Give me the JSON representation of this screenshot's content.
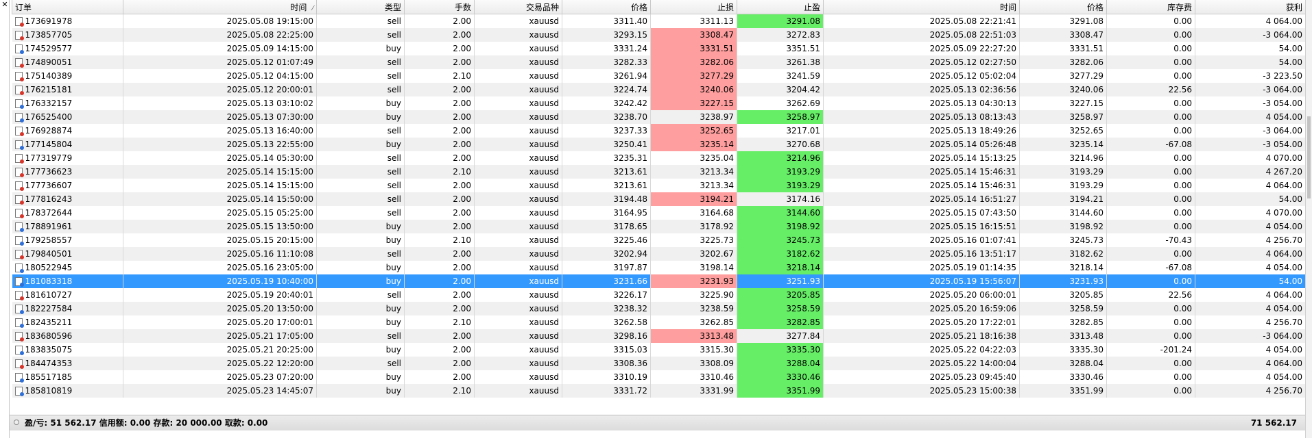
{
  "columns": [
    "订单",
    "时间",
    "类型",
    "手数",
    "交易品种",
    "价格",
    "止损",
    "止盈",
    "时间",
    "价格",
    "库存费",
    "获利"
  ],
  "rows": [
    {
      "id": "173691978",
      "open": "2025.05.08 19:15:00",
      "type": "sell",
      "size": "2.00",
      "symbol": "xauusd",
      "price": "3311.40",
      "sl": "3311.13",
      "tp": "3291.08",
      "close": "2025.05.08 22:21:41",
      "cprice": "3291.08",
      "swap": "0.00",
      "profit": "4 064.00",
      "hl": "tp"
    },
    {
      "id": "173857705",
      "open": "2025.05.08 22:25:00",
      "type": "sell",
      "size": "2.00",
      "symbol": "xauusd",
      "price": "3293.15",
      "sl": "3308.47",
      "tp": "3272.83",
      "close": "2025.05.08 22:51:03",
      "cprice": "3308.47",
      "swap": "0.00",
      "profit": "-3 064.00",
      "hl": "sl"
    },
    {
      "id": "174529577",
      "open": "2025.05.09 14:15:00",
      "type": "buy",
      "size": "2.00",
      "symbol": "xauusd",
      "price": "3331.24",
      "sl": "3331.51",
      "tp": "3351.51",
      "close": "2025.05.09 22:27:20",
      "cprice": "3331.51",
      "swap": "0.00",
      "profit": "54.00",
      "hl": "sl"
    },
    {
      "id": "174890051",
      "open": "2025.05.12 01:07:49",
      "type": "sell",
      "size": "2.00",
      "symbol": "xauusd",
      "price": "3282.33",
      "sl": "3282.06",
      "tp": "3261.38",
      "close": "2025.05.12 02:27:50",
      "cprice": "3282.06",
      "swap": "0.00",
      "profit": "54.00",
      "hl": "sl"
    },
    {
      "id": "175140389",
      "open": "2025.05.12 04:15:00",
      "type": "sell",
      "size": "2.10",
      "symbol": "xauusd",
      "price": "3261.94",
      "sl": "3277.29",
      "tp": "3241.59",
      "close": "2025.05.12 05:02:04",
      "cprice": "3277.29",
      "swap": "0.00",
      "profit": "-3 223.50",
      "hl": "sl"
    },
    {
      "id": "176215181",
      "open": "2025.05.12 20:00:01",
      "type": "sell",
      "size": "2.00",
      "symbol": "xauusd",
      "price": "3224.74",
      "sl": "3240.06",
      "tp": "3204.42",
      "close": "2025.05.13 02:36:56",
      "cprice": "3240.06",
      "swap": "22.56",
      "profit": "-3 064.00",
      "hl": "sl"
    },
    {
      "id": "176332157",
      "open": "2025.05.13 03:10:02",
      "type": "buy",
      "size": "2.00",
      "symbol": "xauusd",
      "price": "3242.42",
      "sl": "3227.15",
      "tp": "3262.69",
      "close": "2025.05.13 04:30:13",
      "cprice": "3227.15",
      "swap": "0.00",
      "profit": "-3 054.00",
      "hl": "sl"
    },
    {
      "id": "176525400",
      "open": "2025.05.13 07:30:00",
      "type": "buy",
      "size": "2.00",
      "symbol": "xauusd",
      "price": "3238.70",
      "sl": "3238.97",
      "tp": "3258.97",
      "close": "2025.05.13 08:13:43",
      "cprice": "3258.97",
      "swap": "0.00",
      "profit": "4 054.00",
      "hl": "tp"
    },
    {
      "id": "176928874",
      "open": "2025.05.13 16:40:00",
      "type": "sell",
      "size": "2.00",
      "symbol": "xauusd",
      "price": "3237.33",
      "sl": "3252.65",
      "tp": "3217.01",
      "close": "2025.05.13 18:49:26",
      "cprice": "3252.65",
      "swap": "0.00",
      "profit": "-3 064.00",
      "hl": "sl"
    },
    {
      "id": "177145804",
      "open": "2025.05.13 22:55:00",
      "type": "buy",
      "size": "2.00",
      "symbol": "xauusd",
      "price": "3250.41",
      "sl": "3235.14",
      "tp": "3270.68",
      "close": "2025.05.14 05:26:48",
      "cprice": "3235.14",
      "swap": "-67.08",
      "profit": "-3 054.00",
      "hl": "sl"
    },
    {
      "id": "177319779",
      "open": "2025.05.14 05:30:00",
      "type": "sell",
      "size": "2.00",
      "symbol": "xauusd",
      "price": "3235.31",
      "sl": "3235.04",
      "tp": "3214.96",
      "close": "2025.05.14 15:13:25",
      "cprice": "3214.96",
      "swap": "0.00",
      "profit": "4 070.00",
      "hl": "tp"
    },
    {
      "id": "177736623",
      "open": "2025.05.14 15:15:00",
      "type": "sell",
      "size": "2.10",
      "symbol": "xauusd",
      "price": "3213.61",
      "sl": "3213.34",
      "tp": "3193.29",
      "close": "2025.05.14 15:46:31",
      "cprice": "3193.29",
      "swap": "0.00",
      "profit": "4 267.20",
      "hl": "tp"
    },
    {
      "id": "177736607",
      "open": "2025.05.14 15:15:00",
      "type": "sell",
      "size": "2.00",
      "symbol": "xauusd",
      "price": "3213.61",
      "sl": "3213.34",
      "tp": "3193.29",
      "close": "2025.05.14 15:46:31",
      "cprice": "3193.29",
      "swap": "0.00",
      "profit": "4 064.00",
      "hl": "tp"
    },
    {
      "id": "177816243",
      "open": "2025.05.14 15:50:00",
      "type": "sell",
      "size": "2.00",
      "symbol": "xauusd",
      "price": "3194.48",
      "sl": "3194.21",
      "tp": "3174.16",
      "close": "2025.05.14 16:51:27",
      "cprice": "3194.21",
      "swap": "0.00",
      "profit": "54.00",
      "hl": "sl"
    },
    {
      "id": "178372644",
      "open": "2025.05.15 05:25:00",
      "type": "sell",
      "size": "2.00",
      "symbol": "xauusd",
      "price": "3164.95",
      "sl": "3164.68",
      "tp": "3144.60",
      "close": "2025.05.15 07:43:50",
      "cprice": "3144.60",
      "swap": "0.00",
      "profit": "4 070.00",
      "hl": "tp"
    },
    {
      "id": "178891961",
      "open": "2025.05.15 13:50:00",
      "type": "buy",
      "size": "2.00",
      "symbol": "xauusd",
      "price": "3178.65",
      "sl": "3178.92",
      "tp": "3198.92",
      "close": "2025.05.15 16:15:51",
      "cprice": "3198.92",
      "swap": "0.00",
      "profit": "4 054.00",
      "hl": "tp"
    },
    {
      "id": "179258557",
      "open": "2025.05.15 20:15:00",
      "type": "buy",
      "size": "2.10",
      "symbol": "xauusd",
      "price": "3225.46",
      "sl": "3225.73",
      "tp": "3245.73",
      "close": "2025.05.16 01:07:41",
      "cprice": "3245.73",
      "swap": "-70.43",
      "profit": "4 256.70",
      "hl": "tp"
    },
    {
      "id": "179840501",
      "open": "2025.05.16 11:10:08",
      "type": "sell",
      "size": "2.00",
      "symbol": "xauusd",
      "price": "3202.94",
      "sl": "3202.67",
      "tp": "3182.62",
      "close": "2025.05.16 13:51:17",
      "cprice": "3182.62",
      "swap": "0.00",
      "profit": "4 064.00",
      "hl": "tp"
    },
    {
      "id": "180522945",
      "open": "2025.05.16 23:05:00",
      "type": "buy",
      "size": "2.00",
      "symbol": "xauusd",
      "price": "3197.87",
      "sl": "3198.14",
      "tp": "3218.14",
      "close": "2025.05.19 01:14:35",
      "cprice": "3218.14",
      "swap": "-67.08",
      "profit": "4 054.00",
      "hl": "tp"
    },
    {
      "id": "181083318",
      "open": "2025.05.19 10:40:00",
      "type": "buy",
      "size": "2.00",
      "symbol": "xauusd",
      "price": "3231.66",
      "sl": "3231.93",
      "tp": "3251.93",
      "close": "2025.05.19 15:56:07",
      "cprice": "3231.93",
      "swap": "0.00",
      "profit": "54.00",
      "hl": "sl",
      "selected": true
    },
    {
      "id": "181610727",
      "open": "2025.05.19 20:40:01",
      "type": "sell",
      "size": "2.00",
      "symbol": "xauusd",
      "price": "3226.17",
      "sl": "3225.90",
      "tp": "3205.85",
      "close": "2025.05.20 06:00:01",
      "cprice": "3205.85",
      "swap": "22.56",
      "profit": "4 064.00",
      "hl": "tp"
    },
    {
      "id": "182227584",
      "open": "2025.05.20 13:50:00",
      "type": "buy",
      "size": "2.00",
      "symbol": "xauusd",
      "price": "3238.32",
      "sl": "3238.59",
      "tp": "3258.59",
      "close": "2025.05.20 16:59:06",
      "cprice": "3258.59",
      "swap": "0.00",
      "profit": "4 054.00",
      "hl": "tp"
    },
    {
      "id": "182435211",
      "open": "2025.05.20 17:00:01",
      "type": "buy",
      "size": "2.10",
      "symbol": "xauusd",
      "price": "3262.58",
      "sl": "3262.85",
      "tp": "3282.85",
      "close": "2025.05.20 17:22:01",
      "cprice": "3282.85",
      "swap": "0.00",
      "profit": "4 256.70",
      "hl": "tp"
    },
    {
      "id": "183680596",
      "open": "2025.05.21 17:05:00",
      "type": "sell",
      "size": "2.00",
      "symbol": "xauusd",
      "price": "3298.16",
      "sl": "3313.48",
      "tp": "3277.84",
      "close": "2025.05.21 18:16:38",
      "cprice": "3313.48",
      "swap": "0.00",
      "profit": "-3 064.00",
      "hl": "sl"
    },
    {
      "id": "183835075",
      "open": "2025.05.21 20:25:00",
      "type": "buy",
      "size": "2.00",
      "symbol": "xauusd",
      "price": "3315.03",
      "sl": "3315.30",
      "tp": "3335.30",
      "close": "2025.05.22 04:22:03",
      "cprice": "3335.30",
      "swap": "-201.24",
      "profit": "4 054.00",
      "hl": "tp"
    },
    {
      "id": "184474353",
      "open": "2025.05.22 12:20:00",
      "type": "sell",
      "size": "2.00",
      "symbol": "xauusd",
      "price": "3308.36",
      "sl": "3308.09",
      "tp": "3288.04",
      "close": "2025.05.22 14:00:04",
      "cprice": "3288.04",
      "swap": "0.00",
      "profit": "4 064.00",
      "hl": "tp"
    },
    {
      "id": "185517185",
      "open": "2025.05.23 07:20:00",
      "type": "buy",
      "size": "2.00",
      "symbol": "xauusd",
      "price": "3310.19",
      "sl": "3310.46",
      "tp": "3330.46",
      "close": "2025.05.23 09:45:40",
      "cprice": "3330.46",
      "swap": "0.00",
      "profit": "4 054.00",
      "hl": "tp"
    },
    {
      "id": "185810819",
      "open": "2025.05.23 14:45:07",
      "type": "buy",
      "size": "2.10",
      "symbol": "xauusd",
      "price": "3331.72",
      "sl": "3331.99",
      "tp": "3351.99",
      "close": "2025.05.23 15:00:38",
      "cprice": "3351.99",
      "swap": "0.00",
      "profit": "4 256.70",
      "hl": "tp"
    }
  ],
  "footer": {
    "summary": "盈/亏: 51 562.17  信用额: 0.00  存款: 20 000.00  取款: 0.00",
    "total": "71 562.17"
  },
  "colors": {
    "sl_highlight": "#ff9e9e",
    "tp_highlight": "#66ee66",
    "selected_row": "#3399ff"
  },
  "icons": {
    "close": "close-icon",
    "row": "order-document-icon",
    "sort": "sort-arrow-icon"
  }
}
